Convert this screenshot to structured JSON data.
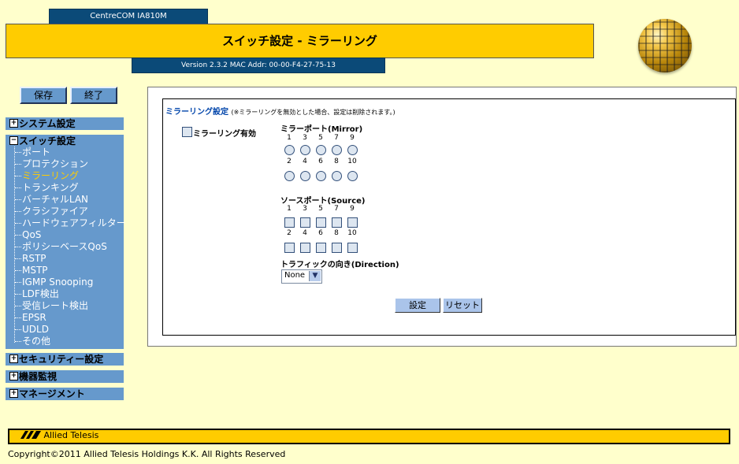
{
  "header": {
    "model": "CentreCOM IA810M",
    "title": "スイッチ設定 - ミラーリング",
    "version": "Version 2.3.2 MAC Addr: 00-00-F4-27-75-13"
  },
  "actions": {
    "save": "保存",
    "exit": "終了"
  },
  "sidebar": {
    "groups": [
      {
        "label": "システム設定",
        "toggle": "+"
      },
      {
        "label": "スイッチ設定",
        "toggle": "−"
      },
      {
        "label": "セキュリティー設定",
        "toggle": "+"
      },
      {
        "label": "機器監視",
        "toggle": "+"
      },
      {
        "label": "マネージメント",
        "toggle": "+"
      }
    ],
    "switch_items": [
      "ポート",
      "プロテクション",
      "ミラーリング",
      "トランキング",
      "バーチャルLAN",
      "クラシファイア",
      "ハードウェアフィルター",
      "QoS",
      "ポリシーベースQoS",
      "RSTP",
      "MSTP",
      "IGMP Snooping",
      "LDF検出",
      "受信レート検出",
      "EPSR",
      "UDLD",
      "その他"
    ],
    "active_item": "ミラーリング"
  },
  "main": {
    "section_title": "ミラーリング設定",
    "section_note": "(※ミラーリングを無効とした場合、設定は削除されます。)",
    "enable_label": "ミラーリング有効",
    "mirror_port_label": "ミラーポート(Mirror)",
    "source_port_label": "ソースポート(Source)",
    "direction_label": "トラフィックの向き(Direction)",
    "direction_value": "None",
    "ports_top": [
      "1",
      "3",
      "5",
      "7",
      "9"
    ],
    "ports_bottom": [
      "2",
      "4",
      "6",
      "8",
      "10"
    ],
    "apply": "設定",
    "reset": "リセット"
  },
  "footer": {
    "logo": "Allied Telesis",
    "copyright": "Copyright©2011 Allied Telesis Holdings K.K. All Rights Reserved"
  },
  "colors": {
    "header_yellow": "#ffcc00",
    "nav_blue": "#6699cc",
    "dark_blue": "#0b4a78",
    "background": "#ffffcc",
    "active_item": "#ffcc00"
  }
}
